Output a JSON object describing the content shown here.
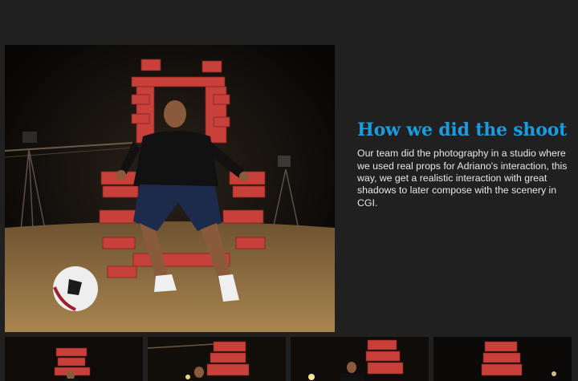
{
  "article": {
    "title": "How we did the shoot",
    "body": "Our team did the photography in a studio where we used real props for Adriano's interaction, this way, we get a realistic interaction with great shadows to later compose with the scenery in CGI."
  },
  "main_image": {
    "icon": "photo-studio-throne"
  },
  "thumbnails": [
    {
      "id": 1,
      "icon": "photo-thumbnail"
    },
    {
      "id": 2,
      "icon": "photo-thumbnail"
    },
    {
      "id": 3,
      "icon": "photo-thumbnail"
    },
    {
      "id": 4,
      "icon": "photo-thumbnail"
    }
  ],
  "colors": {
    "background": "#202020",
    "accent": "#1a9ce0",
    "text": "#e8e8e8",
    "brick": "#c8403a"
  }
}
